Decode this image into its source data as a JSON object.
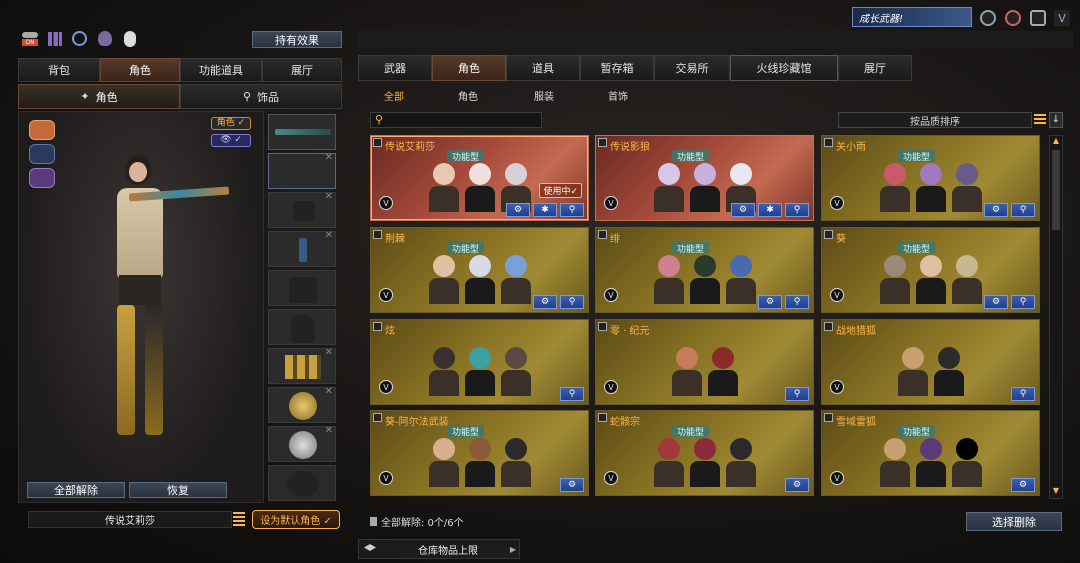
{
  "top_right": {
    "banner_text": "成长武器!"
  },
  "left": {
    "hold_effect_label": "持有效果",
    "tabs": [
      {
        "label": "背包",
        "active": false
      },
      {
        "label": "角色",
        "active": true
      },
      {
        "label": "功能道具",
        "active": false
      },
      {
        "label": "展厅",
        "active": false
      }
    ],
    "subtabs": [
      {
        "label": "角色",
        "active": true
      },
      {
        "label": "饰品",
        "active": false
      }
    ],
    "role_toggle_label": "角色 ✓",
    "eye_toggle_label": "👁 ✓",
    "unequip_all_label": "全部解除",
    "restore_label": "恢复",
    "current_char_name": "传说艾莉莎",
    "set_default_label": "设为默认角色 ✓"
  },
  "right": {
    "tabs": [
      {
        "label": "武器",
        "active": false
      },
      {
        "label": "角色",
        "active": true
      },
      {
        "label": "道具",
        "active": false
      },
      {
        "label": "暂存箱",
        "active": false
      },
      {
        "label": "交易所",
        "active": false
      },
      {
        "label": "火线珍藏馆",
        "active": false
      },
      {
        "label": "展厅",
        "active": false
      }
    ],
    "filters": [
      {
        "label": "全部",
        "active": true
      },
      {
        "label": "角色",
        "active": false
      },
      {
        "label": "服装",
        "active": false
      },
      {
        "label": "首饰",
        "active": false
      }
    ],
    "sort_label": "按品质排序",
    "cards": [
      {
        "name": "传说艾莉莎",
        "type": "功能型",
        "style": "red",
        "in_use": "使用中✓",
        "buttons": 3
      },
      {
        "name": "传说影狼",
        "type": "功能型",
        "style": "red",
        "in_use": "",
        "buttons": 3
      },
      {
        "name": "关小雨",
        "type": "功能型",
        "style": "gold",
        "in_use": "",
        "buttons": 2
      },
      {
        "name": "荆棘",
        "type": "功能型",
        "style": "gold",
        "in_use": "",
        "buttons": 2
      },
      {
        "name": "绯",
        "type": "功能型",
        "style": "gold",
        "in_use": "",
        "buttons": 2
      },
      {
        "name": "葵",
        "type": "功能型",
        "style": "gold",
        "in_use": "",
        "buttons": 2
      },
      {
        "name": "炫",
        "type": "",
        "style": "gold",
        "in_use": "",
        "buttons": 1
      },
      {
        "name": "零 · 纪元",
        "type": "",
        "style": "gold",
        "in_use": "",
        "buttons": 1
      },
      {
        "name": "战地猎狐",
        "type": "",
        "style": "gold",
        "in_use": "",
        "buttons": 1
      },
      {
        "name": "葵-阿尔法武装",
        "type": "功能型",
        "style": "gold",
        "in_use": "",
        "buttons": 1
      },
      {
        "name": "蛇骸宗",
        "type": "功能型",
        "style": "gold",
        "in_use": "",
        "buttons": 1
      },
      {
        "name": "雪域雷狐",
        "type": "功能型",
        "style": "gold",
        "in_use": "",
        "buttons": 1
      }
    ],
    "unequip_status": "全部解除:  0个/6个",
    "select_delete_label": "选择删除",
    "storage_limit_label": "仓库物品上限"
  },
  "colors": {
    "accent_orange": "#ffb648",
    "tab_active": "#5a3a2a",
    "button_blue": "#2a3240"
  }
}
